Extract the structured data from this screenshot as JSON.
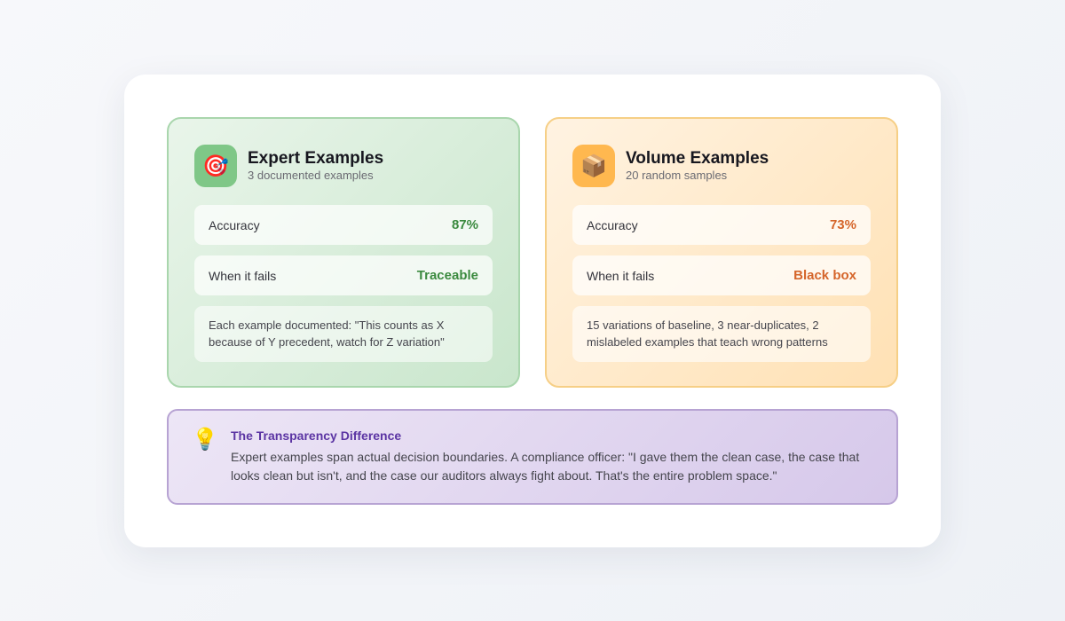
{
  "expert": {
    "icon": "target-icon",
    "title": "Expert Examples",
    "subtitle": "3 documented examples",
    "accuracy_label": "Accuracy",
    "accuracy_value": "87%",
    "fails_label": "When it fails",
    "fails_value": "Traceable",
    "note": "Each example documented: \"This counts as X because of Y precedent, watch for Z variation\"",
    "accent": "#3b8a3f"
  },
  "volume": {
    "icon": "package-icon",
    "title": "Volume Examples",
    "subtitle": "20 random samples",
    "accuracy_label": "Accuracy",
    "accuracy_value": "73%",
    "fails_label": "When it fails",
    "fails_value": "Black box",
    "note": "15 variations of baseline, 3 near-duplicates, 2 mislabeled examples that teach wrong patterns",
    "accent": "#d5652a"
  },
  "callout": {
    "icon": "lightbulb-icon",
    "title": "The Transparency Difference",
    "body": "Expert examples span actual decision boundaries. A compliance officer: \"I gave them the clean case, the case that looks clean but isn't, and the case our auditors always fight about. That's the entire problem space.\"",
    "accent": "#5b34a3"
  }
}
